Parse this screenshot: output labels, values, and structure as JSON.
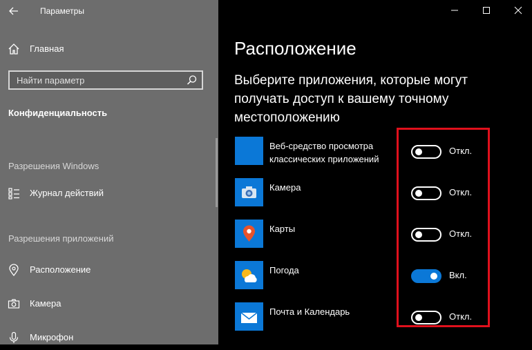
{
  "window": {
    "title": "Параметры"
  },
  "sidebar": {
    "home_label": "Главная",
    "search_placeholder": "Найти параметр",
    "active_section": "Конфиденциальность",
    "group_windows": "Разрешения Windows",
    "item_activity": "Журнал действий",
    "group_apps": "Разрешения приложений",
    "item_location": "Расположение",
    "item_camera": "Камера",
    "item_microphone": "Микрофон"
  },
  "main": {
    "page_title": "Расположение",
    "subtitle": "Выберите приложения, которые могут получать доступ к вашему точному местоположению",
    "apps": [
      {
        "name": "Веб-средство просмотра классических приложений",
        "state": "Откл.",
        "on": false,
        "icon": "blank-app-icon"
      },
      {
        "name": "Камера",
        "state": "Откл.",
        "on": false,
        "icon": "camera-icon"
      },
      {
        "name": "Карты",
        "state": "Откл.",
        "on": false,
        "icon": "maps-pin-icon"
      },
      {
        "name": "Погода",
        "state": "Вкл.",
        "on": true,
        "icon": "weather-sun-icon"
      },
      {
        "name": "Почта и Календарь",
        "state": "Откл.",
        "on": false,
        "icon": "mail-envelope-icon"
      }
    ]
  },
  "colors": {
    "accent": "#0b78d7",
    "highlight": "#e0101c",
    "sidebar_bg": "#6d6d6d"
  }
}
